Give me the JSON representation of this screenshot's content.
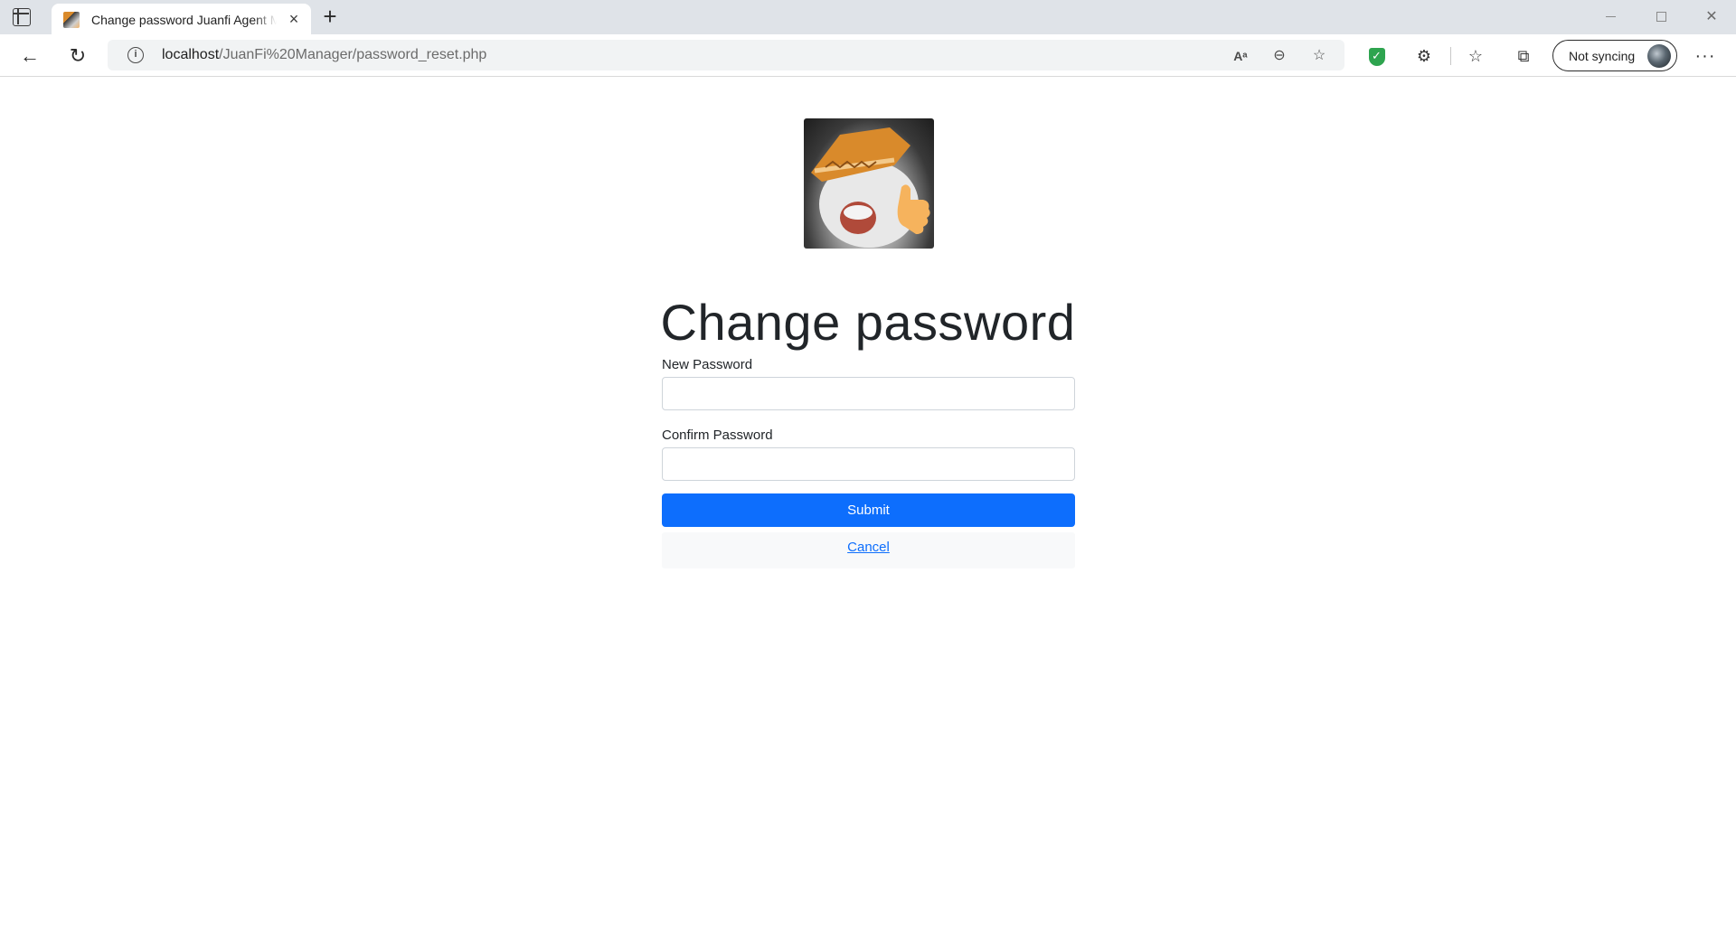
{
  "browser": {
    "tab": {
      "title": "Change password Juanfi Agent Manager"
    },
    "address": {
      "host": "localhost",
      "path": "/JuanFi%20Manager/password_reset.php"
    },
    "profile": {
      "label": "Not syncing"
    },
    "icons": {
      "tab_actions": "tab-actions-icon",
      "new_tab": "+",
      "close_tab": "×",
      "back": "←",
      "reload": "↻",
      "info": "i",
      "read_aloud": "Aᵃ",
      "zoom": "⊖",
      "add_favorite": "☆",
      "extensions": "⚙",
      "favorites": "☆",
      "collections": "⧉",
      "more": "···"
    }
  },
  "page": {
    "heading": "Change password",
    "new_password_label": "New Password",
    "confirm_password_label": "Confirm Password",
    "submit_label": "Submit",
    "cancel_label": "Cancel"
  },
  "colors": {
    "primary": "#0d6efd",
    "heading": "#212529",
    "tab_strip": "#dfe3e8",
    "shield": "#2ea44f"
  }
}
